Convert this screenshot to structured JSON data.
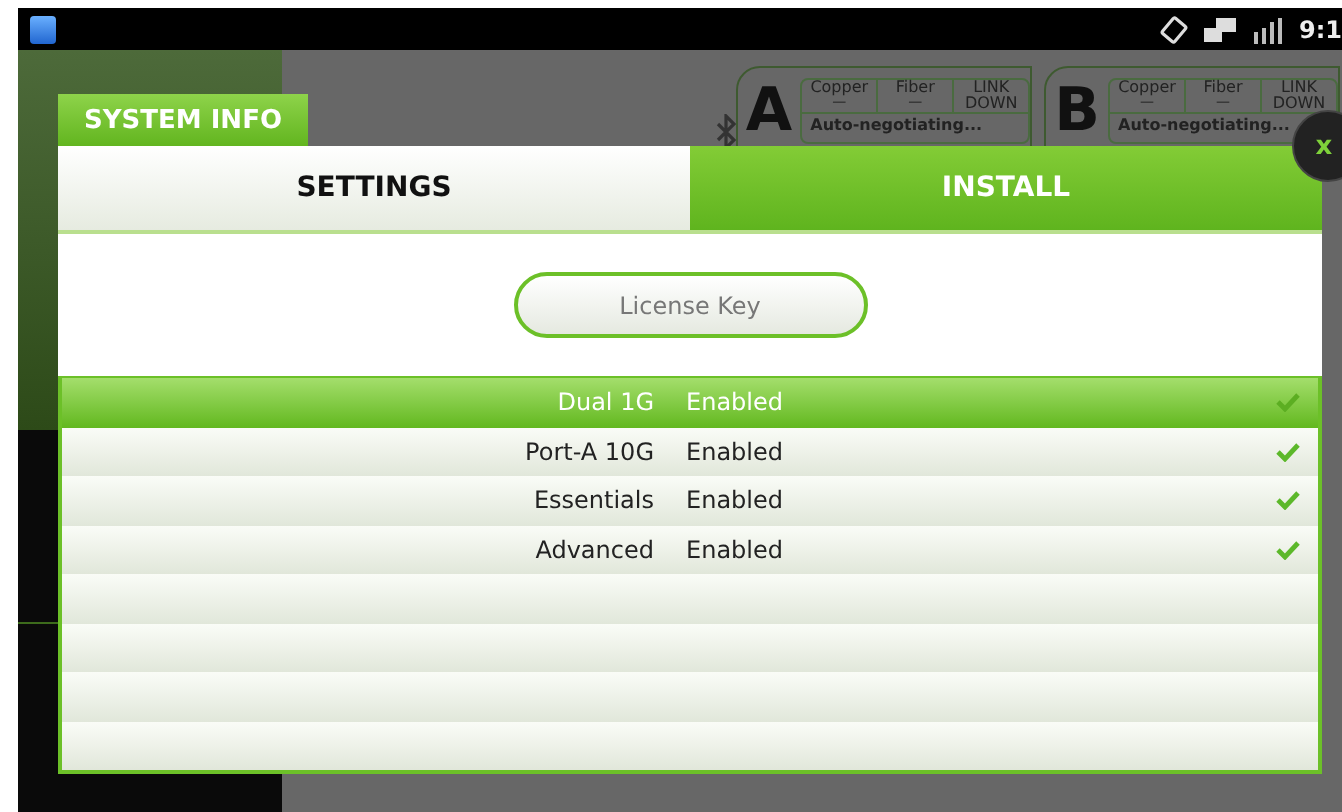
{
  "status_bar": {
    "time": "9:1"
  },
  "ports": [
    {
      "letter": "A",
      "columns": [
        {
          "label": "Copper",
          "value": "—"
        },
        {
          "label": "Fiber",
          "value": "—"
        },
        {
          "label": "LINK DOWN"
        }
      ],
      "status": "Auto-negotiating..."
    },
    {
      "letter": "B",
      "columns": [
        {
          "label": "Copper",
          "value": "—"
        },
        {
          "label": "Fiber",
          "value": "—"
        },
        {
          "label": "LINK DOWN"
        }
      ],
      "status": "Auto-negotiating..."
    }
  ],
  "dialog": {
    "title": "SYSTEM INFO",
    "close": "x",
    "tabs": [
      {
        "label": "SETTINGS",
        "selected": false
      },
      {
        "label": "INSTALL",
        "selected": true
      }
    ],
    "license_button": "License Key",
    "rows": [
      {
        "kind": "feature",
        "name": "Dual 1G",
        "status": "Enabled",
        "checked": true,
        "selected": true
      },
      {
        "kind": "feature",
        "name": "Port-A 10G",
        "status": "Enabled",
        "checked": true,
        "selected": false
      },
      {
        "kind": "feature",
        "name": "Essentials",
        "status": "Enabled",
        "checked": true,
        "selected": false
      },
      {
        "kind": "feature",
        "name": "Advanced",
        "status": "Enabled",
        "checked": true,
        "selected": false
      },
      {
        "kind": "empty"
      },
      {
        "kind": "empty"
      },
      {
        "kind": "empty"
      },
      {
        "kind": "empty"
      }
    ]
  }
}
